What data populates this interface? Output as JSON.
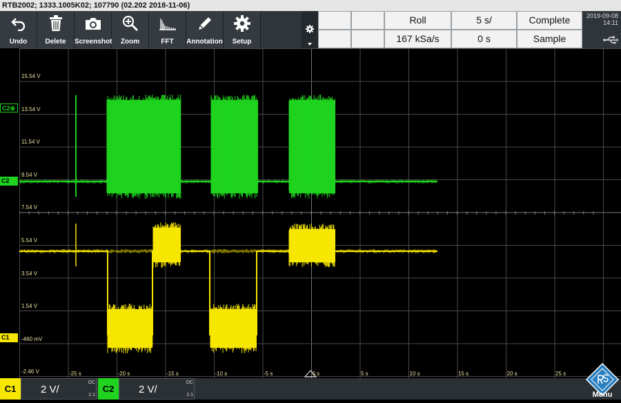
{
  "title": "RTB2002; 1333.1005K02; 107790 (02.202 2018-11-06)",
  "toolbar": [
    {
      "label": "Undo",
      "icon": "undo-icon"
    },
    {
      "label": "Delete",
      "icon": "trash-icon"
    },
    {
      "label": "Screenshot",
      "icon": "camera-icon"
    },
    {
      "label": "Zoom",
      "icon": "zoom-icon"
    },
    {
      "label": "FFT",
      "icon": "fft-icon"
    },
    {
      "label": "Annotation",
      "icon": "pencil-icon"
    },
    {
      "label": "Setup",
      "icon": "gear-icon"
    }
  ],
  "acquisition": {
    "mode": "Roll",
    "timebase": "5 s/",
    "status": "Complete",
    "sample_rate": "167 kSa/s",
    "trigger_offset": "0 s",
    "acq_mode": "Sample"
  },
  "datetime": {
    "date": "2019-09-08",
    "time": "14:11"
  },
  "y_labels": [
    "15.54 V",
    "13.54 V",
    "11.54 V",
    "9.54 V",
    "7.54 V",
    "5.54 V",
    "3.54 V",
    "1.54 V",
    "-460 mV",
    "-2.46 V"
  ],
  "x_labels": [
    "-25 s",
    "-20 s",
    "-15 s",
    "-10 s",
    "-5 s",
    "0 s",
    "5 s",
    "10 s",
    "15 s",
    "20 s",
    "25 s"
  ],
  "markers": {
    "c2_offset": "C2⊕",
    "c2_ground": "C2",
    "c1_ground": "C1"
  },
  "channels": [
    {
      "name": "C1",
      "scale": "2 V/",
      "coupling": "DC",
      "probe": "1:1",
      "color": "#f7e600"
    },
    {
      "name": "C2",
      "scale": "2 V/",
      "coupling": "DC",
      "probe": "1:1",
      "color": "#1fd31f"
    }
  ],
  "menu": {
    "label": "Menu"
  },
  "colors": {
    "c1": "#f7e600",
    "c2": "#1fd31f",
    "grid": "#4a4a4a",
    "toolbar": "#2f353a"
  }
}
